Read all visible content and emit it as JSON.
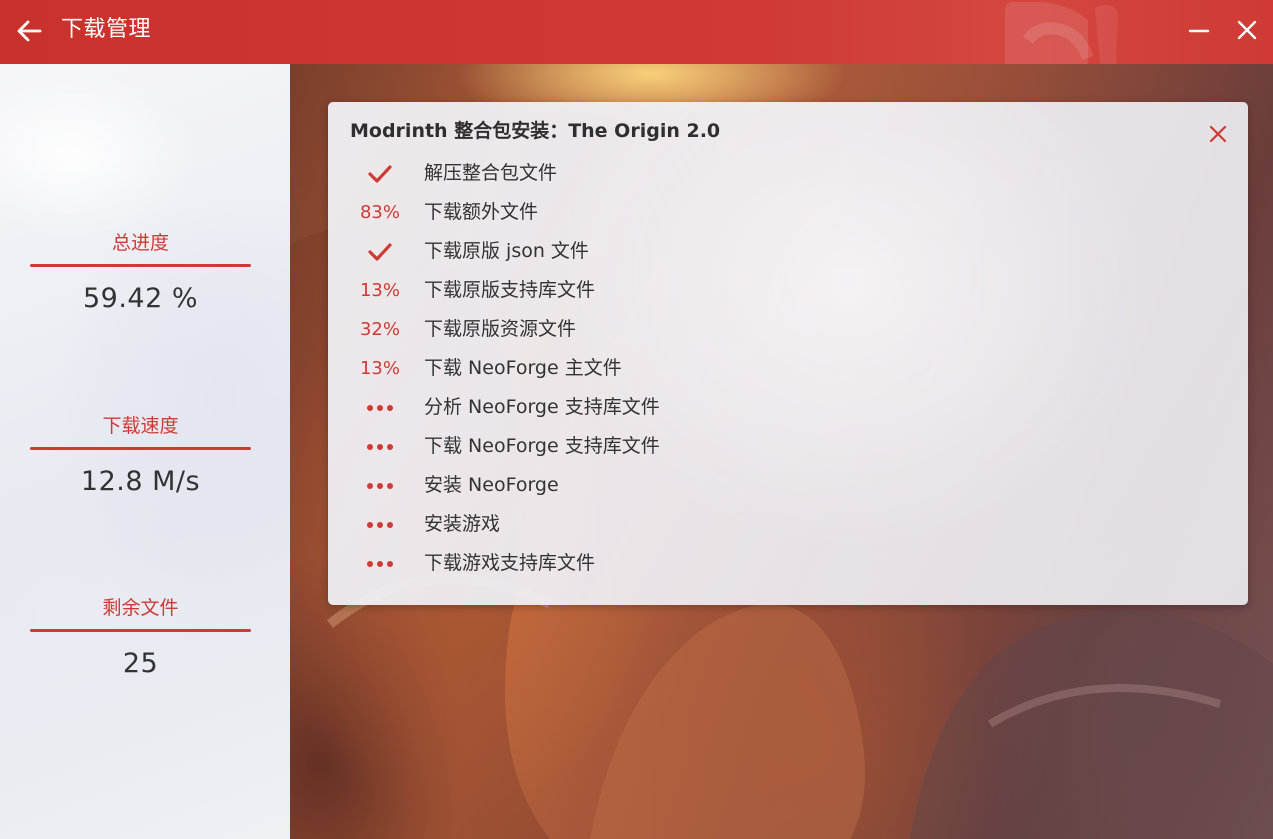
{
  "window": {
    "title": "下载管理",
    "accent": "#cf3a34",
    "titlebar_color": "#cf3a34",
    "back_icon": "arrow-left-icon",
    "minimize_icon": "minimize-icon",
    "close_icon": "close-icon"
  },
  "stats": {
    "total_progress_label": "总进度",
    "total_progress_value": "59.42 %",
    "speed_label": "下载速度",
    "speed_value": "12.8 M/s",
    "remaining_label": "剩余文件",
    "remaining_value": "25"
  },
  "task": {
    "title": "Modrinth 整合包安装：The Origin 2.0",
    "close_icon": "close-icon",
    "steps": [
      {
        "status": "done",
        "status_text": "",
        "label": "解压整合包文件"
      },
      {
        "status": "progress",
        "status_text": "83%",
        "label": "下载额外文件"
      },
      {
        "status": "done",
        "status_text": "",
        "label": "下载原版 json 文件"
      },
      {
        "status": "progress",
        "status_text": "13%",
        "label": "下载原版支持库文件"
      },
      {
        "status": "progress",
        "status_text": "32%",
        "label": "下载原版资源文件"
      },
      {
        "status": "progress",
        "status_text": "13%",
        "label": "下载 NeoForge 主文件"
      },
      {
        "status": "waiting",
        "status_text": "",
        "label": "分析 NeoForge 支持库文件"
      },
      {
        "status": "waiting",
        "status_text": "",
        "label": "下载 NeoForge 支持库文件"
      },
      {
        "status": "waiting",
        "status_text": "",
        "label": "安装 NeoForge"
      },
      {
        "status": "waiting",
        "status_text": "",
        "label": "安装游戏"
      },
      {
        "status": "waiting",
        "status_text": "",
        "label": "下载游戏支持库文件"
      }
    ]
  }
}
